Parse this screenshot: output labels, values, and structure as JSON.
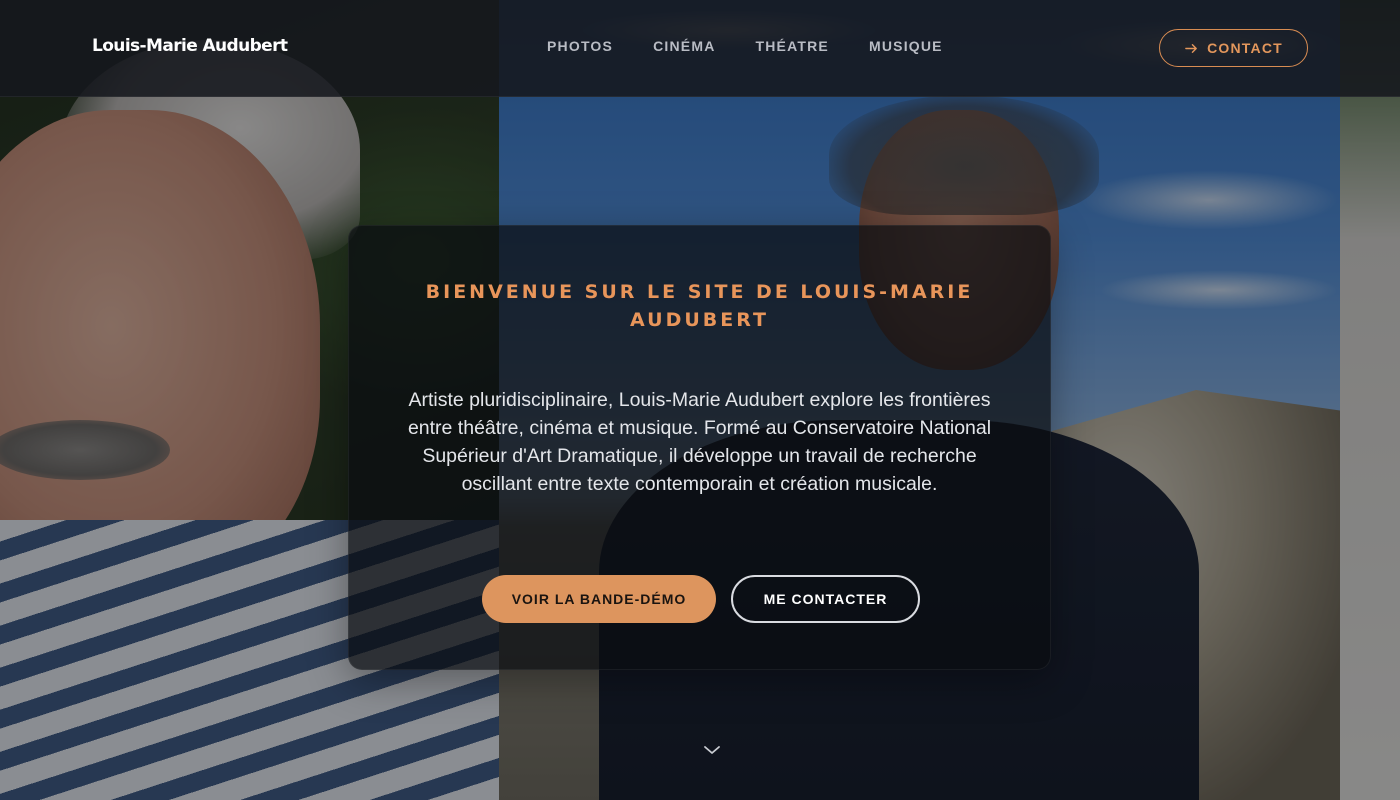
{
  "header": {
    "logo": "Louis-Marie Audubert",
    "nav": [
      {
        "label": "PHOTOS"
      },
      {
        "label": "CINÉMA"
      },
      {
        "label": "THÉATRE"
      },
      {
        "label": "MUSIQUE"
      }
    ],
    "contact_label": "CONTACT",
    "contact_icon": "arrow-right-icon"
  },
  "hero": {
    "title": "BIENVENUE SUR LE SITE DE LOUIS-MARIE AUDUBERT",
    "description": "Artiste pluridisciplinaire, Louis-Marie Audubert explore les frontières entre théâtre, cinéma et musique. Formé au Conservatoire National Supérieur d'Art Dramatique, il développe un travail de recherche oscillant entre texte contemporain et création musicale.",
    "primary_button": "VOIR LA BANDE-DÉMO",
    "secondary_button": "ME CONTACTER",
    "scroll_icon": "chevron-down-icon"
  },
  "colors": {
    "accent": "#dd955e",
    "header_bg": "#16181e",
    "card_bg": "#0a0c10",
    "text_light": "#e4e6ea"
  }
}
